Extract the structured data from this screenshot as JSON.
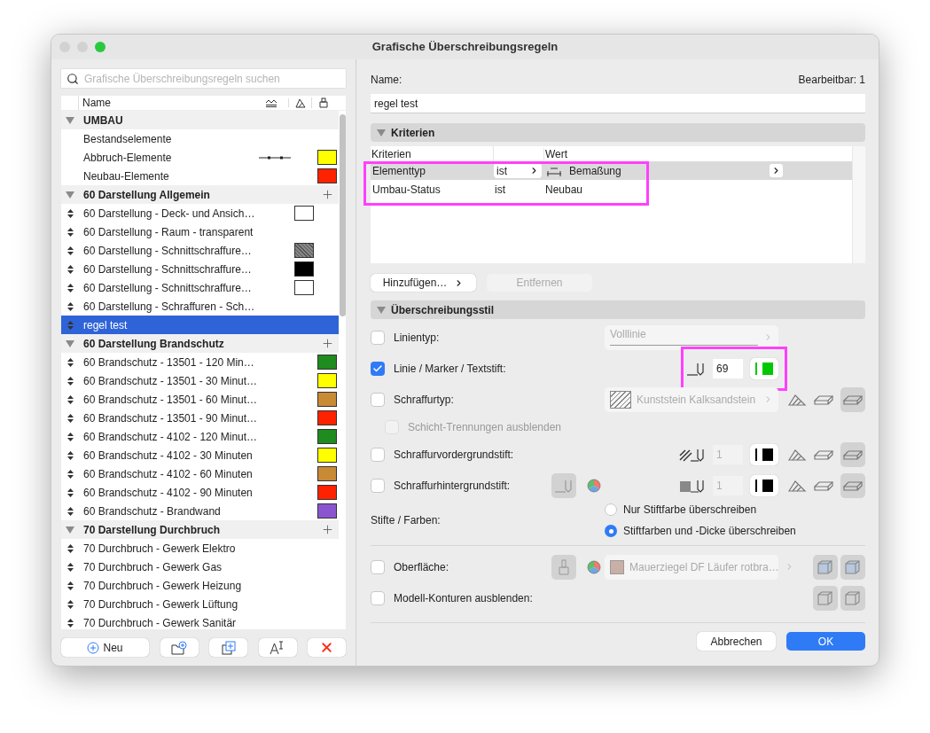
{
  "window": {
    "title": "Grafische Überschreibungsregeln"
  },
  "search": {
    "placeholder": "Grafische Überschreibungsregeln suchen"
  },
  "list_header": {
    "name": "Name"
  },
  "groups": [
    {
      "label": "UMBAU",
      "expanded": true,
      "add_button": false,
      "items": [
        {
          "label": "Bestandselemente",
          "movable": false,
          "selected": false
        },
        {
          "label": "Abbruch-Elemente",
          "movable": false,
          "selected": false,
          "line": true,
          "surface": {
            "color": "#ffff00"
          }
        },
        {
          "label": "Neubau-Elemente",
          "movable": false,
          "selected": false,
          "surface": {
            "color": "#ff2200"
          }
        }
      ]
    },
    {
      "label": "60 Darstellung Allgemein",
      "expanded": true,
      "add_button": true,
      "items": [
        {
          "label": "60 Darstellung - Deck- und Ansich…",
          "movable": true,
          "selected": false,
          "fill": {
            "kind": "solid",
            "color": "#ffffff"
          }
        },
        {
          "label": "60 Darstellung - Raum - transparent",
          "movable": true,
          "selected": false
        },
        {
          "label": "60 Darstellung - Schnittschraffure…",
          "movable": true,
          "selected": false,
          "fill": {
            "kind": "hatch",
            "color": "#888888"
          }
        },
        {
          "label": "60 Darstellung - Schnittschraffure…",
          "movable": true,
          "selected": false,
          "fill": {
            "kind": "solid",
            "color": "#000000"
          }
        },
        {
          "label": "60 Darstellung - Schnittschraffure…",
          "movable": true,
          "selected": false,
          "fill": {
            "kind": "solid",
            "color": "#ffffff"
          }
        },
        {
          "label": "60 Darstellung - Schraffuren - Sch…",
          "movable": true,
          "selected": false
        },
        {
          "label": "regel test",
          "movable": true,
          "selected": true
        }
      ]
    },
    {
      "label": "60 Darstellung Brandschutz",
      "expanded": true,
      "add_button": true,
      "items": [
        {
          "label": "60 Brandschutz - 13501 - 120 Min…",
          "movable": true,
          "selected": false,
          "surface": {
            "color": "#1e8c1e"
          }
        },
        {
          "label": "60 Brandschutz - 13501 - 30 Minut…",
          "movable": true,
          "selected": false,
          "surface": {
            "color": "#ffff00"
          }
        },
        {
          "label": "60 Brandschutz - 13501 - 60 Minut…",
          "movable": true,
          "selected": false,
          "surface": {
            "color": "#c98a35"
          }
        },
        {
          "label": "60 Brandschutz - 13501 - 90 Minut…",
          "movable": true,
          "selected": false,
          "surface": {
            "color": "#ff2200"
          }
        },
        {
          "label": "60 Brandschutz - 4102 - 120 Minut…",
          "movable": true,
          "selected": false,
          "surface": {
            "color": "#1e8c1e"
          }
        },
        {
          "label": "60 Brandschutz - 4102 - 30 Minuten",
          "movable": true,
          "selected": false,
          "surface": {
            "color": "#ffff00"
          }
        },
        {
          "label": "60 Brandschutz - 4102 - 60 Minuten",
          "movable": true,
          "selected": false,
          "surface": {
            "color": "#c98a35"
          }
        },
        {
          "label": "60 Brandschutz - 4102 - 90 Minuten",
          "movable": true,
          "selected": false,
          "surface": {
            "color": "#ff2200"
          }
        },
        {
          "label": "60 Brandschutz - Brandwand",
          "movable": true,
          "selected": false,
          "surface": {
            "color": "#8c55d0"
          }
        }
      ]
    },
    {
      "label": "70 Darstellung Durchbruch",
      "expanded": true,
      "add_button": true,
      "items": [
        {
          "label": "70 Durchbruch - Gewerk Elektro",
          "movable": true,
          "selected": false
        },
        {
          "label": "70 Durchbruch - Gewerk Gas",
          "movable": true,
          "selected": false
        },
        {
          "label": "70 Durchbruch - Gewerk Heizung",
          "movable": true,
          "selected": false
        },
        {
          "label": "70 Durchbruch - Gewerk Lüftung",
          "movable": true,
          "selected": false
        },
        {
          "label": "70 Durchbruch - Gewerk Sanitär",
          "movable": true,
          "selected": false
        }
      ]
    }
  ],
  "toolbar": {
    "new": "Neu"
  },
  "name_field": {
    "label": "Name:",
    "value": "regel test",
    "editable": "Bearbeitbar: 1"
  },
  "criteria": {
    "title": "Kriterien",
    "expanded": true,
    "columns": [
      "Kriterien",
      "Wert"
    ],
    "rows": [
      {
        "criterion": "Elementtyp",
        "operator": "ist",
        "value": "Bemaßung",
        "selected": true
      },
      {
        "criterion": "Umbau-Status",
        "operator": "ist",
        "value": "Neubau",
        "selected": false
      }
    ],
    "add": "Hinzufügen…",
    "remove": {
      "label": "Entfernen",
      "disabled": true
    }
  },
  "style": {
    "title": "Überschreibungsstil",
    "expanded": true,
    "line_type": {
      "label": "Linientyp:",
      "checked": false,
      "value": "Volllinie"
    },
    "pen": {
      "label": "Linie / Marker / Textstift:",
      "checked": true,
      "pen": "69",
      "color": "#00c800"
    },
    "fill_type": {
      "label": "Schraffurtyp:",
      "checked": false,
      "value": "Kunststein Kalksandstein"
    },
    "hide_separators": {
      "label": "Schicht-Trennungen ausblenden",
      "checked": false,
      "disabled": true
    },
    "fill_fg": {
      "label": "Schraffurvordergrundstift:",
      "checked": false,
      "pen": "1",
      "color": "#000000"
    },
    "fill_bg": {
      "label": "Schraffurhintergrundstift:",
      "checked": false,
      "pen": "1",
      "color": "#000000"
    },
    "pens_colors": {
      "label": "Stifte / Farben:",
      "options": [
        {
          "label": "Nur Stiftfarbe überschreiben",
          "selected": false
        },
        {
          "label": "Stiftfarben und -Dicke überschreiben",
          "selected": true
        }
      ]
    },
    "surface": {
      "label": "Oberfläche:",
      "checked": false,
      "value": "Mauerziegel DF Läufer rotbra…",
      "color": "#c9b0a6"
    },
    "hide_contours": {
      "label": "Modell-Konturen ausblenden:",
      "checked": false
    }
  },
  "footer": {
    "cancel": "Abbrechen",
    "ok": "OK"
  }
}
